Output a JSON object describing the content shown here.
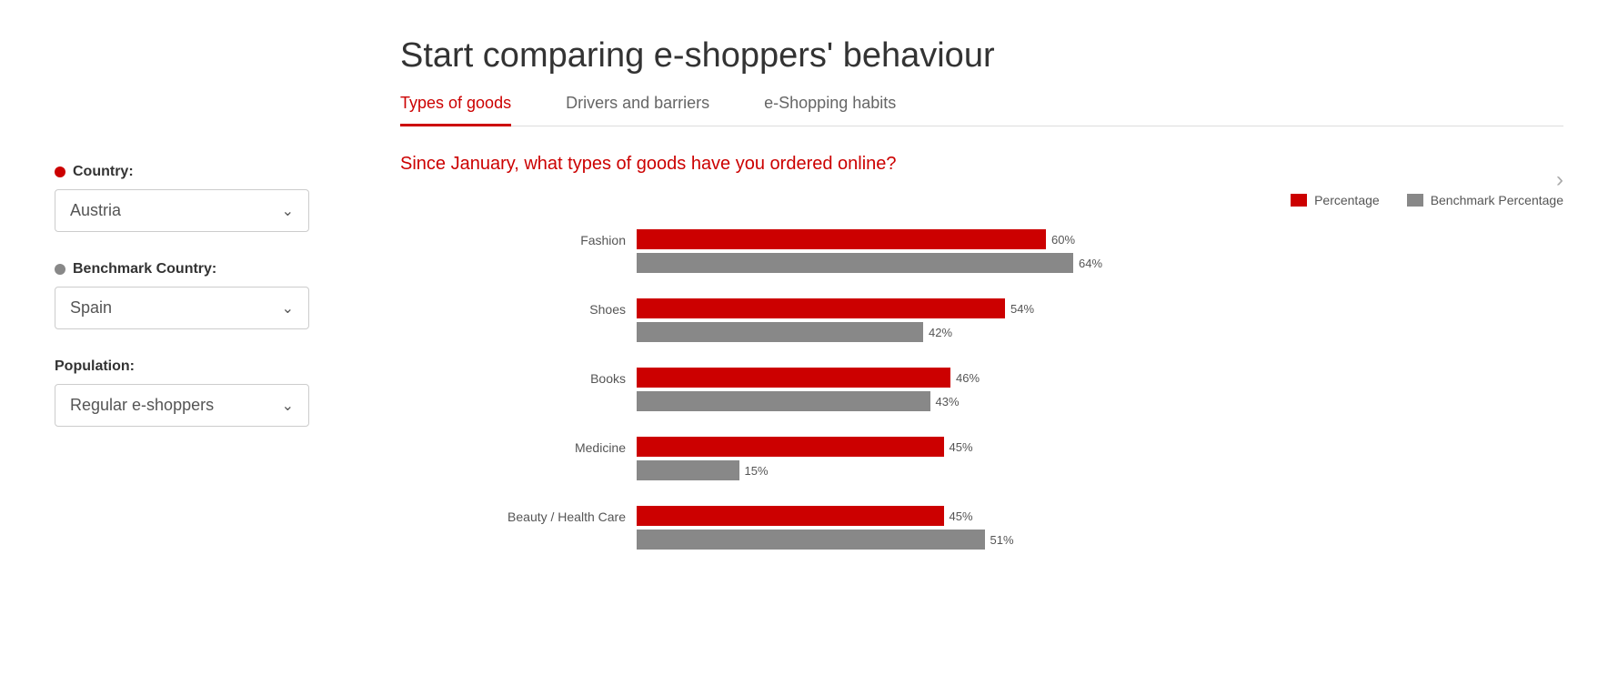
{
  "page": {
    "title": "Start comparing e-shoppers' behaviour"
  },
  "tabs": [
    {
      "id": "types-of-goods",
      "label": "Types of goods",
      "active": true
    },
    {
      "id": "drivers-and-barriers",
      "label": "Drivers and barriers",
      "active": false
    },
    {
      "id": "eshopping-habits",
      "label": "e-Shopping habits",
      "active": false
    }
  ],
  "question": "Since January, what types of goods have you ordered online?",
  "legend": {
    "percentage_label": "Percentage",
    "benchmark_label": "Benchmark Percentage"
  },
  "filters": {
    "country_label": "Country:",
    "country_value": "Austria",
    "benchmark_label": "Benchmark Country:",
    "benchmark_value": "Spain",
    "population_label": "Population:",
    "population_value": "Regular e-shoppers"
  },
  "chart": {
    "max_width": 750,
    "rows": [
      {
        "category": "Fashion",
        "percentage": 60,
        "benchmark": 64
      },
      {
        "category": "Shoes",
        "percentage": 54,
        "benchmark": 42
      },
      {
        "category": "Books",
        "percentage": 46,
        "benchmark": 43
      },
      {
        "category": "Medicine",
        "percentage": 45,
        "benchmark": 15
      },
      {
        "category": "Beauty / Health Care",
        "percentage": 45,
        "benchmark": 51
      }
    ]
  },
  "colors": {
    "accent": "#cc0000",
    "gray": "#888",
    "border": "#ddd"
  }
}
